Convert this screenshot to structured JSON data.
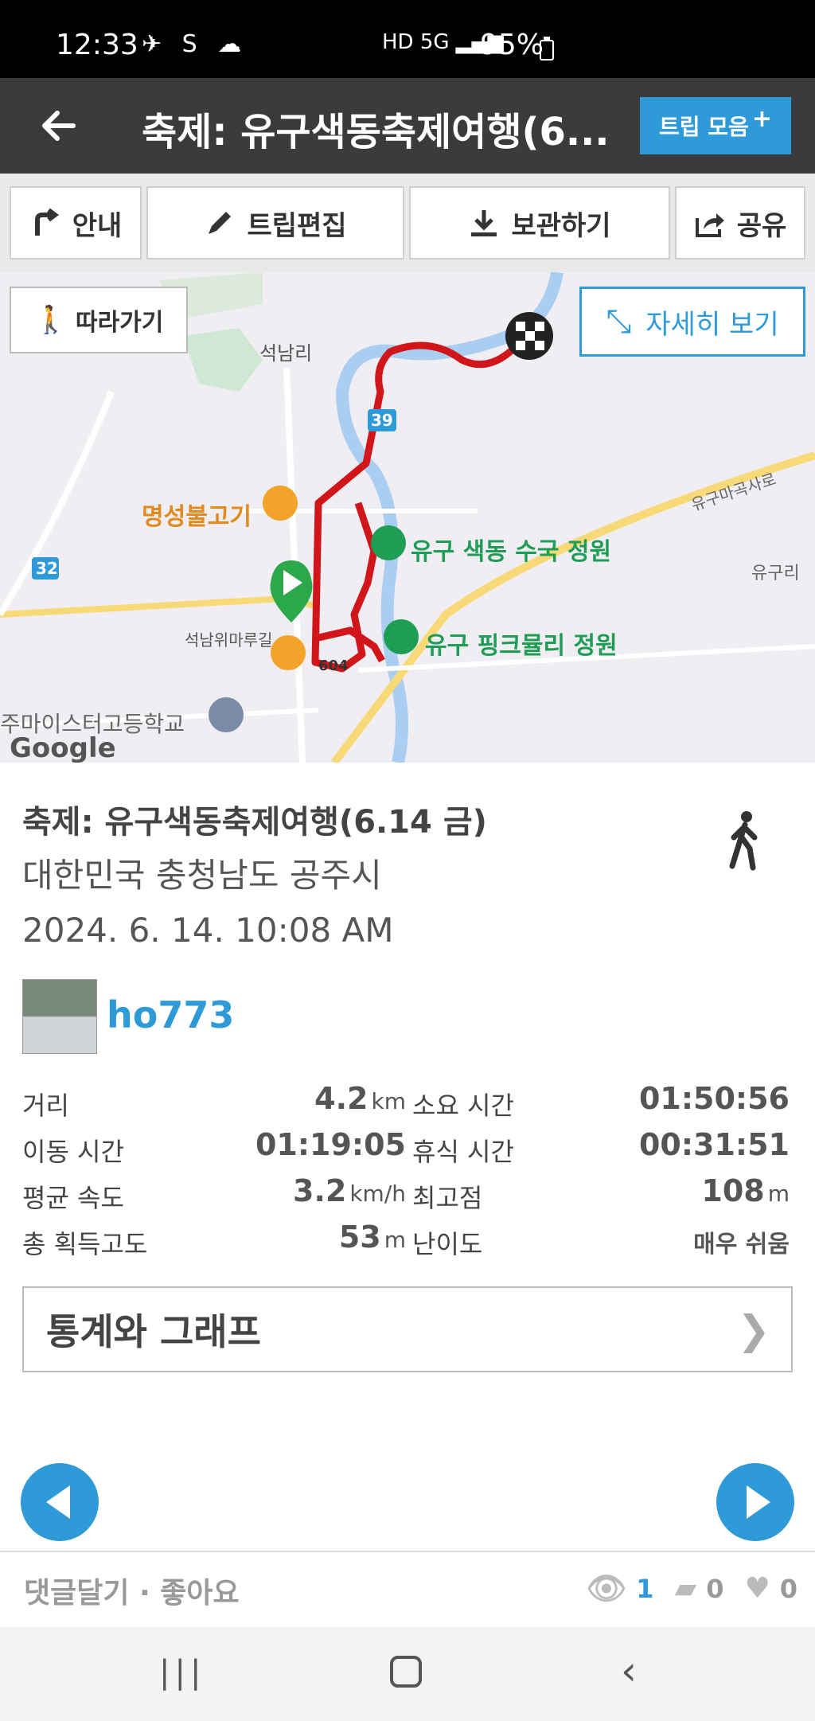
{
  "status": {
    "time": "12:33",
    "battery": "95%"
  },
  "header": {
    "title": "축제: 유구색동축제여행(6....",
    "trip_collect_label": "트립 모음"
  },
  "toolbar": {
    "guide_label": "안내",
    "edit_label": "트립편집",
    "save_label": "보관하기",
    "share_label": "공유"
  },
  "map": {
    "follow_label": "따라가기",
    "detail_label": "자세히 보기",
    "labels": {
      "seoknamri": "석남리",
      "myeongseong": "명성불고기",
      "garden1": "유구 색동 수국 정원",
      "garden2": "유구 핑크뮬리 정원",
      "yugu_ri": "유구리",
      "road_yugu": "유구마곡사로",
      "school": "주마이스터고등학교",
      "seoknam_road": "석남위마루길",
      "route_39": "39",
      "route_32": "32",
      "route_604": "604",
      "google": "Google"
    }
  },
  "trip": {
    "title": "축제: 유구색동축제여행(6.14 금)",
    "location": "대한민국 충청남도 공주시",
    "date": "2024. 6. 14. 10:08 AM",
    "user": "ho773"
  },
  "stats": {
    "distance_label": "거리",
    "distance_value": "4.2",
    "distance_unit": "km",
    "duration_label": "소요 시간",
    "duration_value": "01:50:56",
    "moving_label": "이동 시간",
    "moving_value": "01:19:05",
    "rest_label": "휴식 시간",
    "rest_value": "00:31:51",
    "speed_label": "평균 속도",
    "speed_value": "3.2",
    "speed_unit": "km/h",
    "max_label": "최고점",
    "max_value": "108",
    "max_unit": "m",
    "gain_label": "총 획득고도",
    "gain_value": "53",
    "gain_unit": "m",
    "difficulty_label": "난이도",
    "difficulty_value": "매우 쉬움"
  },
  "stats_button": {
    "label": "통계와 그래프"
  },
  "footer": {
    "comment_like": "댓글달기 · 좋아요",
    "views": "1",
    "comments": "0",
    "likes": "0"
  },
  "colors": {
    "accent": "#2f9ad8",
    "route": "#d0161b",
    "titlebar": "#3b3b3b"
  }
}
